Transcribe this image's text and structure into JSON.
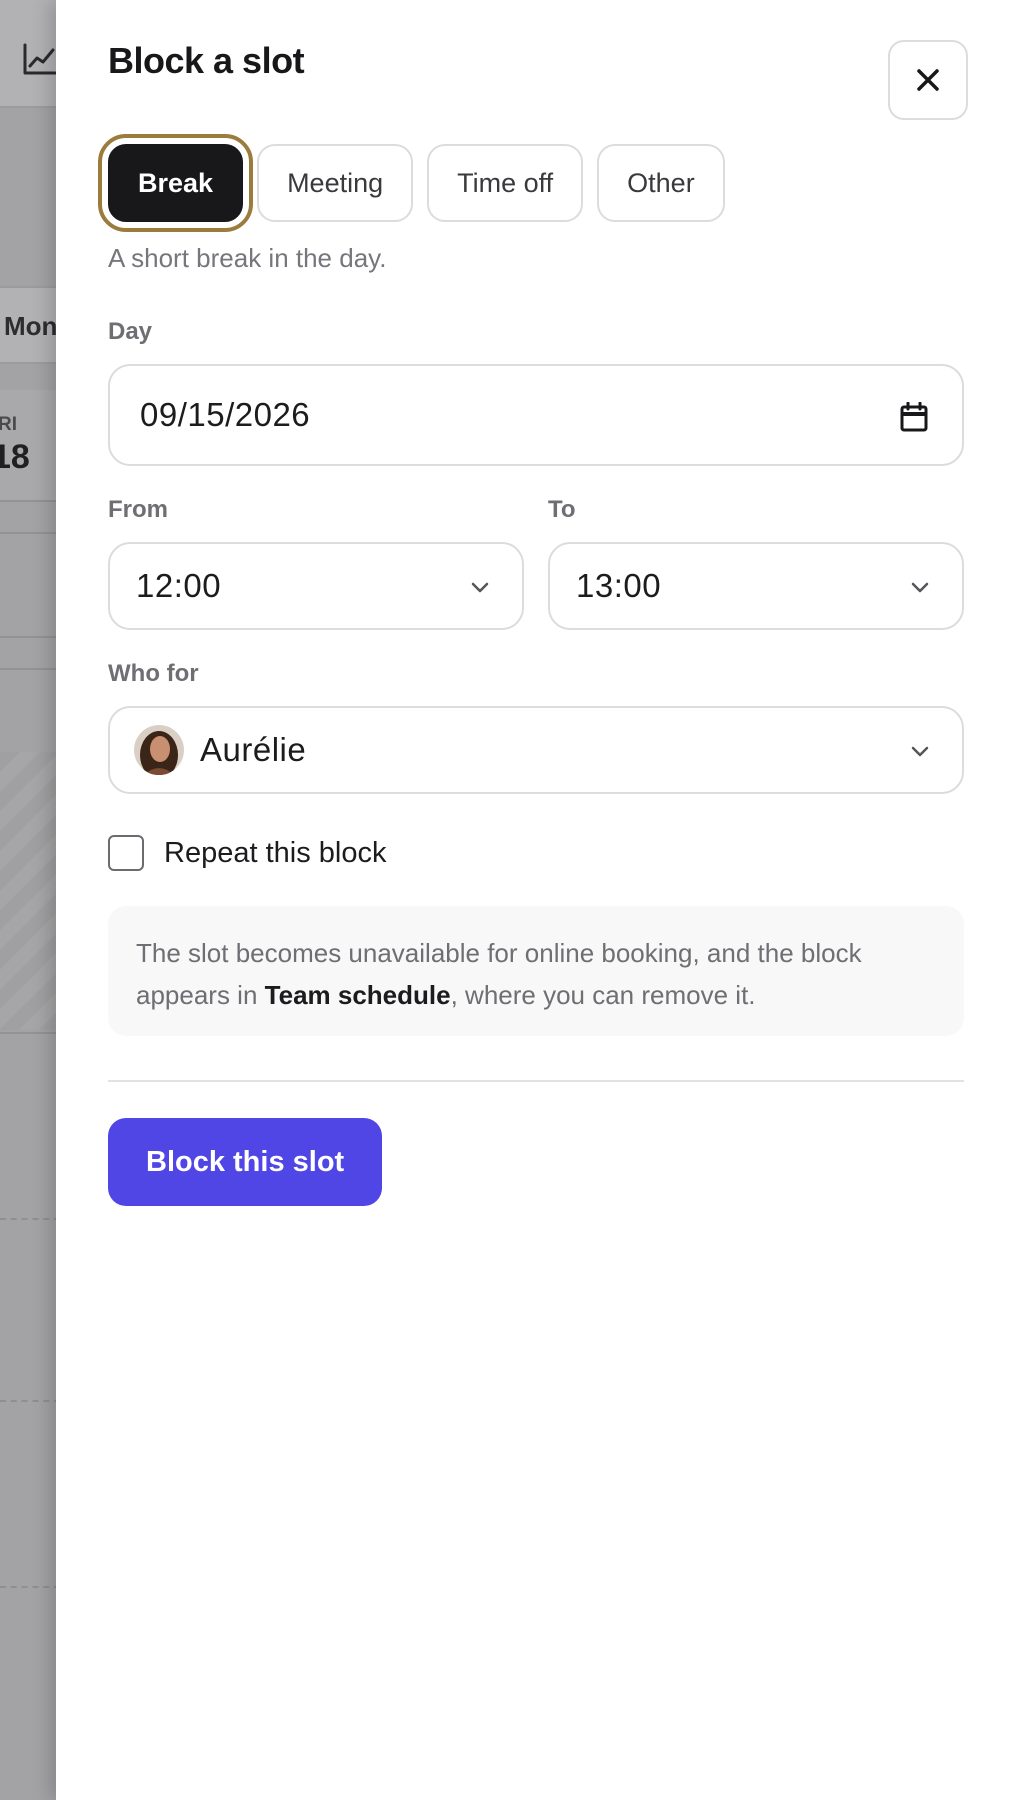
{
  "background": {
    "month_label": "Mon",
    "day_of_week": "RI",
    "day_number": "18",
    "chart_icon": "chart-line-icon"
  },
  "sheet": {
    "title": "Block a slot",
    "close_icon": "close-icon",
    "types": [
      {
        "label": "Break",
        "active": true
      },
      {
        "label": "Meeting",
        "active": false
      },
      {
        "label": "Time off",
        "active": false
      },
      {
        "label": "Other",
        "active": false
      }
    ],
    "type_help": "A short break in the day.",
    "day": {
      "label": "Day",
      "value": "09/15/2026",
      "icon": "calendar-icon"
    },
    "from": {
      "label": "From",
      "value": "12:00",
      "icon": "chevron-down-icon"
    },
    "to": {
      "label": "To",
      "value": "13:00",
      "icon": "chevron-down-icon"
    },
    "who": {
      "label": "Who for",
      "value": "Aurélie",
      "icon": "chevron-down-icon"
    },
    "repeat": {
      "label": "Repeat this block",
      "checked": false
    },
    "info": {
      "before": "The slot becomes unavailable for online booking, and the block appears in ",
      "bold": "Team schedule",
      "after": ", where you can remove it."
    },
    "submit_label": "Block this slot"
  },
  "colors": {
    "primary": "#4f46e5",
    "active_chip": "#18181b",
    "focus_ring": "#9c7c3c"
  }
}
